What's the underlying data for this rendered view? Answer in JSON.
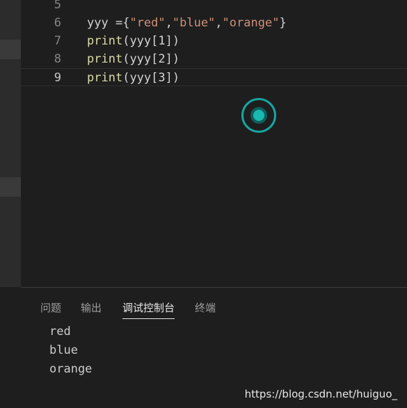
{
  "editor": {
    "lines": [
      {
        "number": "5",
        "code": ""
      },
      {
        "number": "6",
        "code": "yyy ={\"red\",\"blue\",\"orange\"}"
      },
      {
        "number": "7",
        "code": "print(yyy[1])"
      },
      {
        "number": "8",
        "code": "print(yyy[2])"
      },
      {
        "number": "9",
        "code": "print(yyy[3])"
      }
    ],
    "current_line": "9"
  },
  "panel": {
    "tabs": [
      {
        "label": "问题"
      },
      {
        "label": "输出"
      },
      {
        "label": "调试控制台",
        "active": true
      },
      {
        "label": "终端"
      }
    ],
    "output_lines": [
      "red",
      "blue",
      "orange"
    ]
  },
  "watermark": "https://blog.csdn.net/huiguo_",
  "colors": {
    "background": "#1e1e1e",
    "string": "#ce9178",
    "function": "#dcdcaa",
    "spinner": "#1bb8b0"
  },
  "icons": [
    "loading-spinner-icon"
  ]
}
